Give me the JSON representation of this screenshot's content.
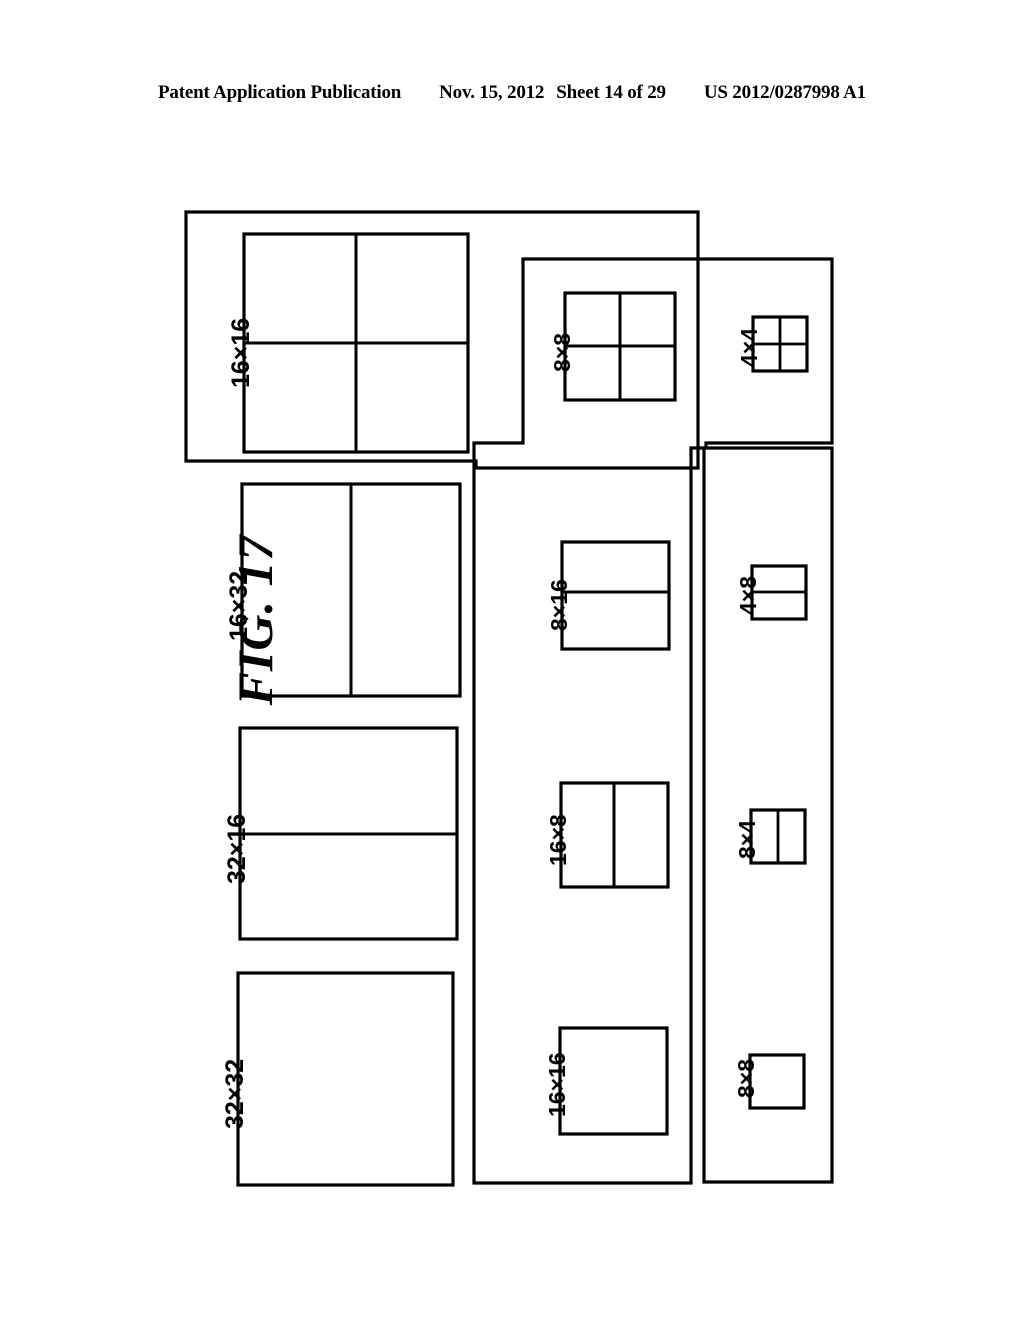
{
  "header": {
    "publication": "Patent Application Publication",
    "date": "Nov. 15, 2012",
    "sheet": "Sheet 14 of 29",
    "doc_number": "US 2012/0287998 A1"
  },
  "figure": {
    "title": "FIG. 17",
    "line_color": "#000000",
    "background": "#ffffff"
  },
  "blocks": {
    "b_16x16_top": {
      "label": "16×16",
      "splits": "quad"
    },
    "b_16x32": {
      "label": "16×32",
      "splits": "vertical"
    },
    "b_32x16": {
      "label": "32×16",
      "splits": "horizontal"
    },
    "b_32x32": {
      "label": "32×32",
      "splits": "none"
    },
    "b_8x8_top": {
      "label": "8×8",
      "splits": "quad"
    },
    "b_8x16": {
      "label": "8×16",
      "splits": "horizontal"
    },
    "b_16x8": {
      "label": "16×8",
      "splits": "vertical"
    },
    "b_16x16_bot": {
      "label": "16×16",
      "splits": "none"
    },
    "b_4x4": {
      "label": "4×4",
      "splits": "quad"
    },
    "b_4x8": {
      "label": "4×8",
      "splits": "horizontal"
    },
    "b_8x4": {
      "label": "8×4",
      "splits": "vertical"
    },
    "b_8x8_bot": {
      "label": "8×8",
      "splits": "none"
    }
  }
}
